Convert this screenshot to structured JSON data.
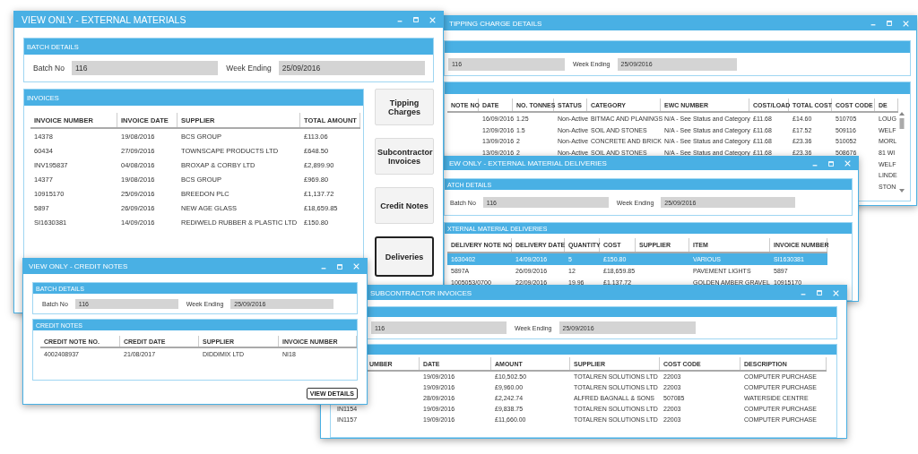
{
  "windows": [
    {
      "kind": "main",
      "title": "VIEW ONLY - EXTERNAL MATERIALS",
      "batch": {
        "heading": "BATCH DETAILS",
        "batch_label": "Batch No",
        "batch_value": "116",
        "week_label": "Week Ending",
        "week_value": "25/09/2016"
      },
      "table": {
        "heading": "INVOICES",
        "columns": [
          "INVOICE NUMBER",
          "INVOICE DATE",
          "SUPPLIER",
          "TOTAL AMOUNT"
        ],
        "rows": [
          {
            "cells": [
              "14378",
              "19/08/2016",
              "BCS GROUP",
              "£113.06"
            ],
            "selected": false
          },
          {
            "cells": [
              "60434",
              "27/09/2016",
              "TOWNSCAPE PRODUCTS LTD",
              "£648.50"
            ],
            "selected": false
          },
          {
            "cells": [
              "INV195837",
              "04/08/2016",
              "BROXAP & CORBY LTD",
              "£2,899.90"
            ],
            "selected": false
          },
          {
            "cells": [
              "14377",
              "19/08/2016",
              "BCS GROUP",
              "£969.80"
            ],
            "selected": false
          },
          {
            "cells": [
              "10915170",
              "25/09/2016",
              "BREEDON PLC",
              "£1,137.72"
            ],
            "selected": false
          },
          {
            "cells": [
              "5897",
              "26/09/2016",
              "NEW AGE GLASS",
              "£18,659.85"
            ],
            "selected": false
          },
          {
            "cells": [
              "SI1630381",
              "14/09/2016",
              "REDIWELD RUBBER & PLASTIC LTD",
              "£150.80"
            ],
            "selected": false
          }
        ]
      },
      "buttons": [
        {
          "label": "Tipping Charges",
          "selected": false
        },
        {
          "label": "Subcontractor Invoices",
          "selected": false
        },
        {
          "label": "Credit Notes",
          "selected": false
        },
        {
          "label": "Deliveries",
          "selected": true
        }
      ]
    },
    {
      "kind": "tipping",
      "title": "TIPPING CHARGE DETAILS",
      "batch": {
        "batch_value": "116",
        "week_label": "Week Ending",
        "week_value": "25/09/2016"
      },
      "table": {
        "columns": [
          "NOTE NO",
          "DATE",
          "NO. TONNES",
          "STATUS",
          "CATEGORY",
          "EWC NUMBER",
          "COST/LOAD",
          "TOTAL COST",
          "COST CODE",
          "DE"
        ],
        "rows": [
          {
            "cells": [
              null,
              "16/09/2016",
              "1.25",
              "Non-Active",
              "BITMAC AND PLANINGS",
              "N/A - See Status and Category",
              "£11.68",
              "£14.60",
              "510705",
              "LOUG"
            ],
            "selected": false
          },
          {
            "cells": [
              null,
              "12/09/2016",
              "1.5",
              "Non-Active",
              "SOIL AND STONES",
              "N/A - See Status and Category",
              "£11.68",
              "£17.52",
              "509116",
              "WELF"
            ],
            "selected": false
          },
          {
            "cells": [
              null,
              "13/09/2016",
              "2",
              "Non-Active",
              "CONCRETE AND BRICK",
              "N/A - See Status and Category",
              "£11.68",
              "£23.36",
              "510052",
              "MORL"
            ],
            "selected": false
          },
          {
            "cells": [
              null,
              "13/09/2016",
              "2",
              "Non-Active",
              "SOIL AND STONES",
              "N/A - See Status and Category",
              "£11.68",
              "£23.36",
              "508676",
              "81 WI"
            ],
            "selected": false
          },
          {
            "cells": [
              null,
              null,
              null,
              null,
              null,
              null,
              null,
              null,
              null,
              "WELF"
            ],
            "selected": false
          },
          {
            "cells": [
              null,
              null,
              null,
              null,
              null,
              null,
              null,
              null,
              null,
              "LINDE"
            ],
            "selected": false
          },
          {
            "cells": [
              null,
              null,
              null,
              null,
              null,
              null,
              null,
              null,
              null,
              "STON"
            ],
            "selected": false
          }
        ]
      }
    },
    {
      "kind": "deliveries",
      "title": "EW ONLY - EXTERNAL MATERIAL DELIVERIES",
      "batch": {
        "heading": "ATCH DETAILS",
        "batch_label": "Batch No",
        "batch_value": "116",
        "week_label": "Week Ending",
        "week_value": "25/09/2016"
      },
      "table": {
        "heading": "XTERNAL MATERIAL DELIVERIES",
        "columns": [
          "DELIVERY NOTE NO",
          "DELIVERY DATE",
          "QUANTITY",
          "COST",
          "SUPPLIER",
          "ITEM",
          "INVOICE NUMBER"
        ],
        "rows": [
          {
            "cells": [
              "1630402",
              "14/09/2016",
              "5",
              "£150.80",
              null,
              "VARIOUS",
              "SI1630381"
            ],
            "selected": true
          },
          {
            "cells": [
              "5897A",
              "26/09/2016",
              "12",
              "£18,659.85",
              null,
              "PAVEMENT LIGHTS",
              "5897"
            ],
            "selected": false
          },
          {
            "cells": [
              "1005053/0700",
              "22/09/2016",
              "19.96",
              "£1,137.72",
              null,
              "GOLDEN AMBER GRAVEL",
              "10915170"
            ],
            "selected": false
          }
        ]
      }
    },
    {
      "kind": "credit",
      "title": "VIEW ONLY - CREDIT NOTES",
      "batch": {
        "heading": "BATCH DETAILS",
        "batch_label": "Batch No",
        "batch_value": "116",
        "week_label": "Week Ending",
        "week_value": "25/09/2016"
      },
      "table": {
        "heading": "CREDIT NOTES",
        "columns": [
          "CREDIT NOTE NO.",
          "CREDIT DATE",
          "SUPPLIER",
          "INVOICE NUMBER"
        ],
        "rows": [
          {
            "cells": [
              "4002408937",
              "21/08/2017",
              "DIDDIMIX LTD",
              "NI18"
            ],
            "selected": false
          }
        ]
      },
      "footer_button": "VIEW DETAILS"
    },
    {
      "kind": "subcontractor",
      "title": "SUBCONTRACTOR INVOICES",
      "batch": {
        "batch_value": "116",
        "week_label": "Week Ending",
        "week_value": "25/09/2016"
      },
      "table": {
        "columns": [
          "UMBER",
          "DATE",
          "AMOUNT",
          "SUPPLIER",
          "COST CODE",
          "DESCRIPTION"
        ],
        "rows": [
          {
            "cells": [
              null,
              "19/09/2016",
              "£10,502.50",
              "TOTALREN SOLUTIONS LTD",
              "22003",
              "COMPUTER PURCHASE"
            ],
            "selected": false
          },
          {
            "cells": [
              null,
              "19/09/2016",
              "£9,960.00",
              "TOTALREN SOLUTIONS LTD",
              "22003",
              "COMPUTER PURCHASE"
            ],
            "selected": false
          },
          {
            "cells": [
              null,
              "28/09/2016",
              "£2,242.74",
              "ALFRED BAGNALL & SONS",
              "507085",
              "WATERSIDE CENTRE"
            ],
            "selected": false
          },
          {
            "cells": [
              "IN1154",
              "19/09/2016",
              "£9,838.75",
              "TOTALREN SOLUTIONS LTD",
              "22003",
              "COMPUTER PURCHASE"
            ],
            "selected": false
          },
          {
            "cells": [
              "IN1157",
              "19/09/2016",
              "£11,660.00",
              "TOTALREN SOLUTIONS LTD",
              "22003",
              "COMPUTER PURCHASE"
            ],
            "selected": false
          }
        ]
      }
    }
  ]
}
